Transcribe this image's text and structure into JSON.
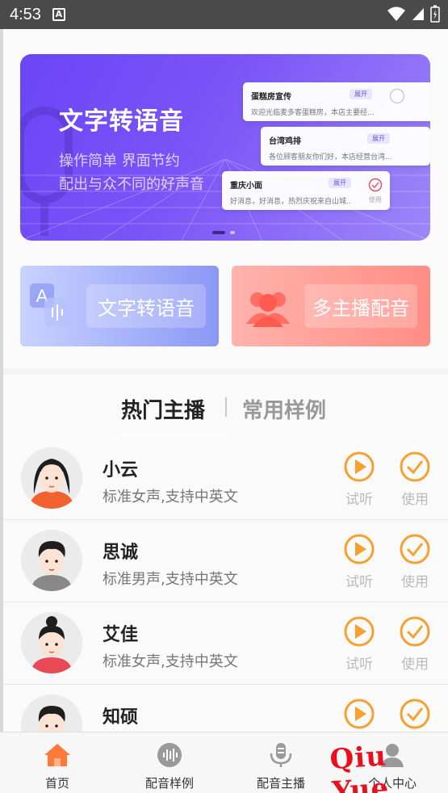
{
  "status_bar": {
    "time": "4:53",
    "notification_icon": "A"
  },
  "banner": {
    "title": "文字转语音",
    "subtitle_1": "操作简单 界面节约",
    "subtitle_2": "配出与众不同的好声音",
    "cards": [
      {
        "title": "蛋糕房宣传",
        "tag": "展开",
        "desc": "欢迎光临麦多客蛋糕房，本店主要经..."
      },
      {
        "title": "台湾鸡排",
        "tag": "展开",
        "desc": "各位顾客朋友你们好，本店经营台湾..."
      },
      {
        "title": "重庆小面",
        "tag": "展开",
        "desc": "好消息，好消息，热烈庆祝来自山城...",
        "use": "使用"
      }
    ]
  },
  "features": {
    "tts_label": "文字转语音",
    "multi_label": "多主播配音"
  },
  "tabs": {
    "hot": "热门主播",
    "common": "常用样例"
  },
  "anchors": [
    {
      "name": "小云",
      "desc": "标准女声,支持中英文",
      "listen": "试听",
      "use": "使用"
    },
    {
      "name": "思诚",
      "desc": "标准男声,支持中英文",
      "listen": "试听",
      "use": "使用"
    },
    {
      "name": "艾佳",
      "desc": "标准女声,支持中英文",
      "listen": "试听",
      "use": "使用"
    },
    {
      "name": "知硕",
      "desc": "",
      "listen": "",
      "use": ""
    }
  ],
  "bottom_nav": [
    {
      "label": "首页",
      "icon": "home-icon",
      "active": true
    },
    {
      "label": "配音样例",
      "icon": "waveform-icon"
    },
    {
      "label": "配音主播",
      "icon": "microphone-icon"
    },
    {
      "label": "个人中心",
      "icon": "person-icon"
    }
  ],
  "watermark": "Qiu Yue",
  "colors": {
    "accent": "#f5a030",
    "banner": "#6a45f5",
    "nav_active": "#ff7a3a"
  }
}
